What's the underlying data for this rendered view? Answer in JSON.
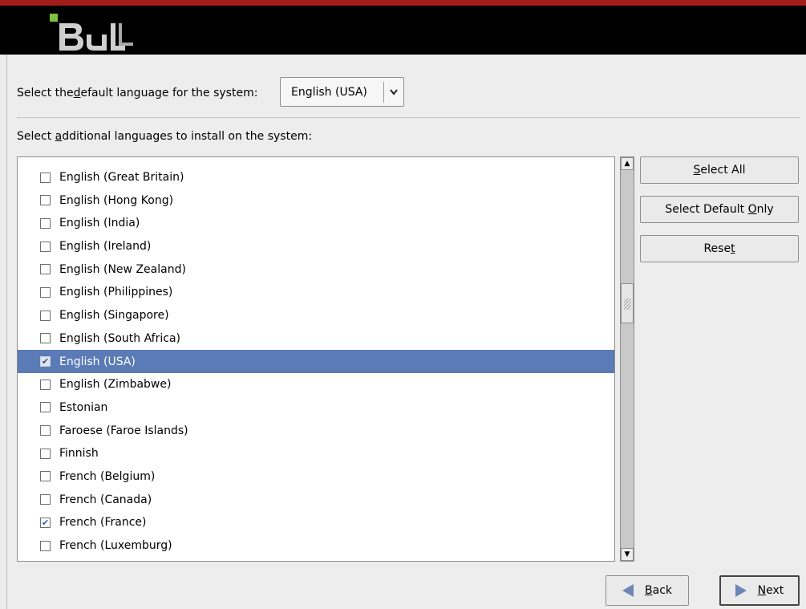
{
  "header": {
    "logo_text": "BULL"
  },
  "default_language": {
    "label_pre": "Select the ",
    "label_mnemonic": "d",
    "label_post": "efault language for the system:",
    "selected": "English (USA)"
  },
  "additional": {
    "label_pre": "Select ",
    "label_mnemonic": "a",
    "label_post": "dditional languages to install on the system:"
  },
  "languages": [
    {
      "label": "English (Great Britain)",
      "checked": false,
      "selected": false
    },
    {
      "label": "English (Hong Kong)",
      "checked": false,
      "selected": false
    },
    {
      "label": "English (India)",
      "checked": false,
      "selected": false
    },
    {
      "label": "English (Ireland)",
      "checked": false,
      "selected": false
    },
    {
      "label": "English (New Zealand)",
      "checked": false,
      "selected": false
    },
    {
      "label": "English (Philippines)",
      "checked": false,
      "selected": false
    },
    {
      "label": "English (Singapore)",
      "checked": false,
      "selected": false
    },
    {
      "label": "English (South Africa)",
      "checked": false,
      "selected": false
    },
    {
      "label": "English (USA)",
      "checked": true,
      "selected": true
    },
    {
      "label": "English (Zimbabwe)",
      "checked": false,
      "selected": false
    },
    {
      "label": "Estonian",
      "checked": false,
      "selected": false
    },
    {
      "label": "Faroese (Faroe Islands)",
      "checked": false,
      "selected": false
    },
    {
      "label": "Finnish",
      "checked": false,
      "selected": false
    },
    {
      "label": "French (Belgium)",
      "checked": false,
      "selected": false
    },
    {
      "label": "French (Canada)",
      "checked": false,
      "selected": false
    },
    {
      "label": "French (France)",
      "checked": true,
      "selected": false
    },
    {
      "label": "French (Luxemburg)",
      "checked": false,
      "selected": false
    }
  ],
  "buttons": {
    "select_all": {
      "pre": "",
      "mnemonic": "S",
      "post": "elect All"
    },
    "select_default_only": {
      "pre": "Select Default ",
      "mnemonic": "O",
      "post": "nly"
    },
    "reset": {
      "pre": "Rese",
      "mnemonic": "t",
      "post": ""
    },
    "back": {
      "pre": "",
      "mnemonic": "B",
      "post": "ack"
    },
    "next": {
      "pre": "",
      "mnemonic": "N",
      "post": "ext"
    }
  },
  "icons": {
    "combo_arrow": "chevron-down-icon",
    "scroll_up": "scroll-up-arrow-icon",
    "scroll_down": "scroll-down-arrow-icon",
    "back": "arrow-left-icon",
    "next": "arrow-right-icon"
  },
  "colors": {
    "selection": "#5a7bb5",
    "banner": "#000000",
    "top_strip": "#a21c1c",
    "arrow": "#6c86b8"
  }
}
